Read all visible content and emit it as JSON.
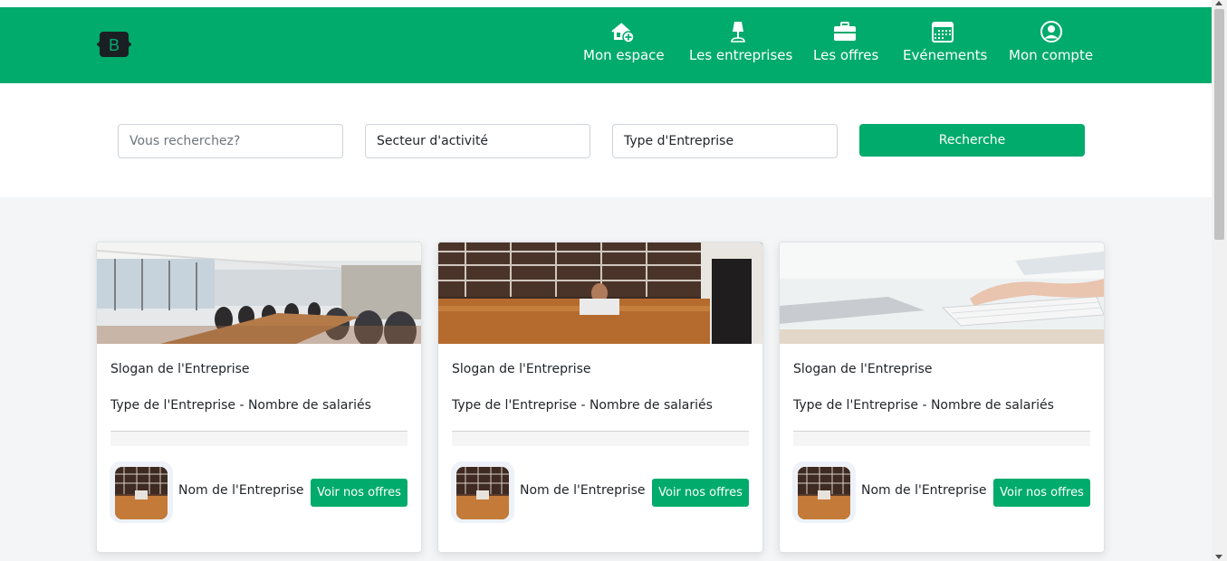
{
  "brand": {
    "letter": "B",
    "icon": "bootstrap-logo-icon"
  },
  "nav": {
    "items": [
      {
        "label": "Mon espace",
        "icon": "house-add-icon"
      },
      {
        "label": "Les entreprises",
        "icon": "lamp-icon"
      },
      {
        "label": "Les offres",
        "icon": "briefcase-icon"
      },
      {
        "label": "Evénements",
        "icon": "calendar-icon"
      },
      {
        "label": "Mon compte",
        "icon": "person-circle-icon"
      }
    ]
  },
  "search": {
    "keyword_placeholder": "Vous recherchez?",
    "sector_value": "Secteur d'activité",
    "type_value": "Type d'Entreprise",
    "button_label": "Recherche"
  },
  "cards": [
    {
      "slogan": "Slogan de l'Entreprise",
      "type_line": "Type de l'Entreprise - Nombre de salariés",
      "company_name": "Nom de l'Entreprise",
      "button_label": "Voir nos offres"
    },
    {
      "slogan": "Slogan de l'Entreprise",
      "type_line": "Type de l'Entreprise - Nombre de salariés",
      "company_name": "Nom de l'Entreprise",
      "button_label": "Voir nos offres"
    },
    {
      "slogan": "Slogan de l'Entreprise",
      "type_line": "Type de l'Entreprise - Nombre de salariés",
      "company_name": "Nom de l'Entreprise",
      "button_label": "Voir nos offres"
    }
  ],
  "colors": {
    "primary": "#00ab6c",
    "page_bg": "#f3f5f7",
    "text": "#212529"
  }
}
